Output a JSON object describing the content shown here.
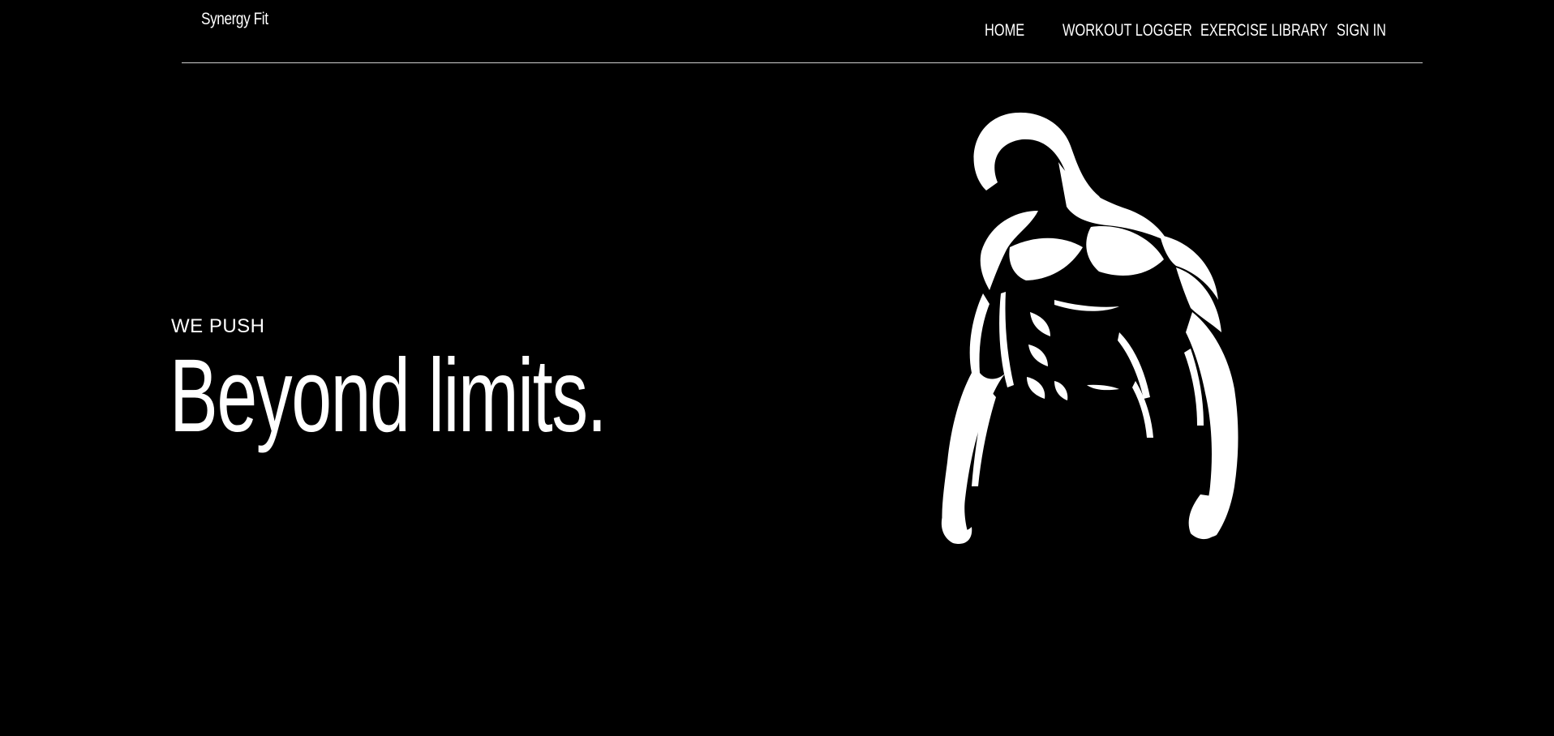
{
  "header": {
    "brand": "Synergy Fit",
    "nav": [
      {
        "label": "HOME"
      },
      {
        "label": "WORKOUT LOGGER"
      },
      {
        "label": "EXERCISE LIBRARY"
      },
      {
        "label": "SIGN IN"
      }
    ]
  },
  "hero": {
    "eyebrow": "WE PUSH",
    "headline": "Beyond limits.",
    "image_icon": "muscular-torso-silhouette"
  },
  "colors": {
    "background": "#000000",
    "text": "#ffffff",
    "divider": "#cfcfcf"
  }
}
